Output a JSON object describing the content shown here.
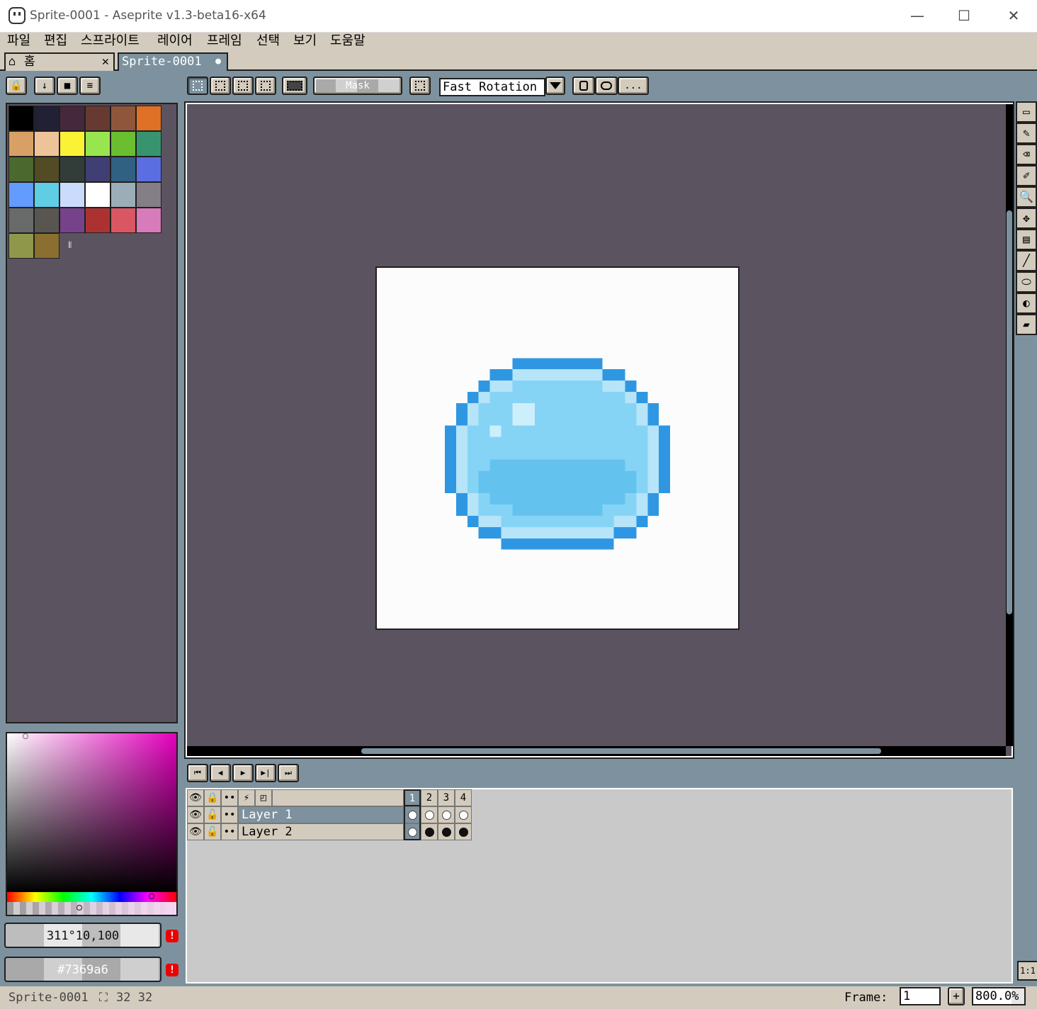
{
  "window": {
    "title": "Sprite-0001 - Aseprite v1.3-beta16-x64",
    "minimize": "—",
    "maximize": "☐",
    "close": "✕"
  },
  "menu": [
    "파일",
    "편집",
    "스프라이트",
    "레이어",
    "프레임",
    "선택",
    "보기",
    "도움말"
  ],
  "tabs": {
    "home_icon": "⌂",
    "home_label": "홈",
    "home_close": "✕",
    "sprite_label": "Sprite-0001",
    "sprite_modified": "●"
  },
  "palette_toolbar": {
    "lock": "🔒",
    "sort": "↓",
    "presets": "■",
    "options": "≡"
  },
  "context_bar": {
    "mask_label": "Mask",
    "rotation_algorithm": "Fast Rotation",
    "more_label": "..."
  },
  "palette": {
    "colors": [
      "#000000",
      "#222034",
      "#45283c",
      "#663931",
      "#8f563b",
      "#df7126",
      "#d9a066",
      "#eec39a",
      "#fbf236",
      "#99e550",
      "#6abe30",
      "#37946e",
      "#4b692f",
      "#524b24",
      "#323c39",
      "#3f3f74",
      "#306082",
      "#5b6ee1",
      "#639bff",
      "#5fcde4",
      "#cbdbfc",
      "#ffffff",
      "#9badb7",
      "#847e87",
      "#696a6a",
      "#595652",
      "#76428a",
      "#ac3232",
      "#d95763",
      "#d77bba",
      "#8f974a",
      "#8a6f30"
    ],
    "resize_handle": "⦀"
  },
  "color_picker": {
    "hsv_value": "311°10,100",
    "hex_value": "#7369a6",
    "warning": "!"
  },
  "tools": [
    "▭",
    "✎",
    "⌫",
    "✐",
    "🔍",
    "✥",
    "▤",
    "╱",
    "⬭",
    "◐",
    "▰"
  ],
  "zoom_reset": "1:1",
  "timeline": {
    "controls": [
      "⏮",
      "◀",
      "▶",
      "▶|",
      "⏭"
    ],
    "header_icons": [
      "👁",
      "🔒",
      "••",
      "⚡",
      "◰"
    ],
    "frames": [
      "1",
      "2",
      "3",
      "4"
    ],
    "layers": [
      {
        "name": "Layer 1",
        "eye": "👁",
        "lock": "🔓",
        "link": "••",
        "cels": [
          "empty",
          "empty",
          "empty",
          "empty"
        ]
      },
      {
        "name": "Layer 2",
        "eye": "👁",
        "lock": "🔓",
        "link": "••",
        "cels": [
          "empty",
          "full",
          "full",
          "full"
        ]
      }
    ]
  },
  "status": {
    "sprite_name": "Sprite-0001",
    "size_icon": "⛶",
    "size": "32 32",
    "frame_label": "Frame:",
    "frame_value": "1",
    "add_frame": "+",
    "zoom": "800.0%"
  },
  "sprite_colors": {
    "outline": "#2f97e2",
    "highlight": "#b6e4f8",
    "body": "#86d4f5",
    "shade": "#64c3ee",
    "spot": "#cdeefb"
  }
}
